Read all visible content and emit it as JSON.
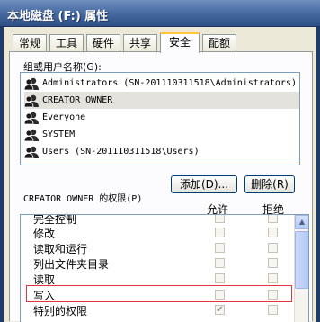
{
  "window": {
    "title": "本地磁盘 (F:) 属性"
  },
  "tabs": [
    {
      "label": "常规"
    },
    {
      "label": "工具"
    },
    {
      "label": "硬件"
    },
    {
      "label": "共享"
    },
    {
      "label": "安全"
    },
    {
      "label": "配额"
    }
  ],
  "active_tab": "安全",
  "groups": {
    "label": "组或用户名称(G):",
    "items": [
      {
        "name": "Administrators (SN-201110311518\\Administrators)",
        "icon": "users-group-icon"
      },
      {
        "name": "CREATOR OWNER",
        "icon": "users-group-icon",
        "selected": true
      },
      {
        "name": "Everyone",
        "icon": "users-group-icon"
      },
      {
        "name": "SYSTEM",
        "icon": "users-group-icon"
      },
      {
        "name": "Users (SN-201110311518\\Users)",
        "icon": "users-group-icon"
      }
    ]
  },
  "buttons": {
    "add": "添加(D)...",
    "remove": "删除(R)"
  },
  "permissions": {
    "label": "CREATOR OWNER 的权限(P)",
    "allow_header": "允许",
    "deny_header": "拒绝",
    "rows": [
      {
        "name": "完全控制",
        "allow": false,
        "deny": false
      },
      {
        "name": "修改",
        "allow": false,
        "deny": false
      },
      {
        "name": "读取和运行",
        "allow": false,
        "deny": false
      },
      {
        "name": "列出文件夹目录",
        "allow": false,
        "deny": false
      },
      {
        "name": "读取",
        "allow": false,
        "deny": false
      },
      {
        "name": "写入",
        "allow": false,
        "deny": false,
        "highlighted": true
      },
      {
        "name": "特别的权限",
        "allow": true,
        "deny": false
      }
    ]
  },
  "colors": {
    "highlight_border": "#e0383a",
    "active_tab_accent": "#ffc83c"
  }
}
